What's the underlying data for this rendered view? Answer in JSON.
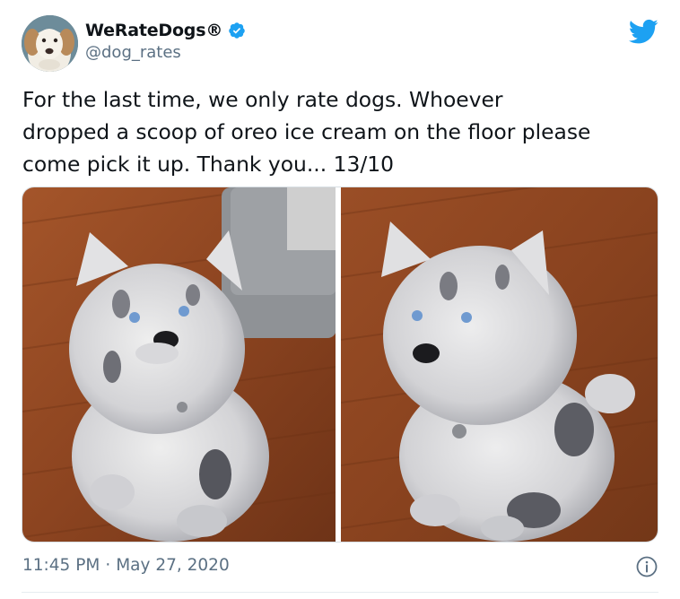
{
  "author": {
    "display_name": "WeRateDogs®",
    "handle": "@dog_rates",
    "verified": true,
    "avatar_icon": "dog-avatar"
  },
  "tweet": {
    "text": "For the last time, we only rate dogs. Whoever\ndropped a scoop of oreo ice cream on the floor please\ncome pick it up. Thank you... 13/10",
    "time": "11:45 PM",
    "separator": "·",
    "date": "May 27, 2020"
  },
  "media": {
    "photos": [
      {
        "subject": "merle fluffy puppy sitting on wood floor next to grey couch"
      },
      {
        "subject": "merle fluffy puppy sitting on wood floor, head tilted"
      }
    ]
  },
  "icons": {
    "brand": "twitter-bird-icon",
    "verified": "verified-badge-icon",
    "info": "info-icon"
  },
  "colors": {
    "twitter_blue": "#1da1f2",
    "text_primary": "#0f1419",
    "text_secondary": "#5b7083",
    "border": "#d7dee3"
  }
}
